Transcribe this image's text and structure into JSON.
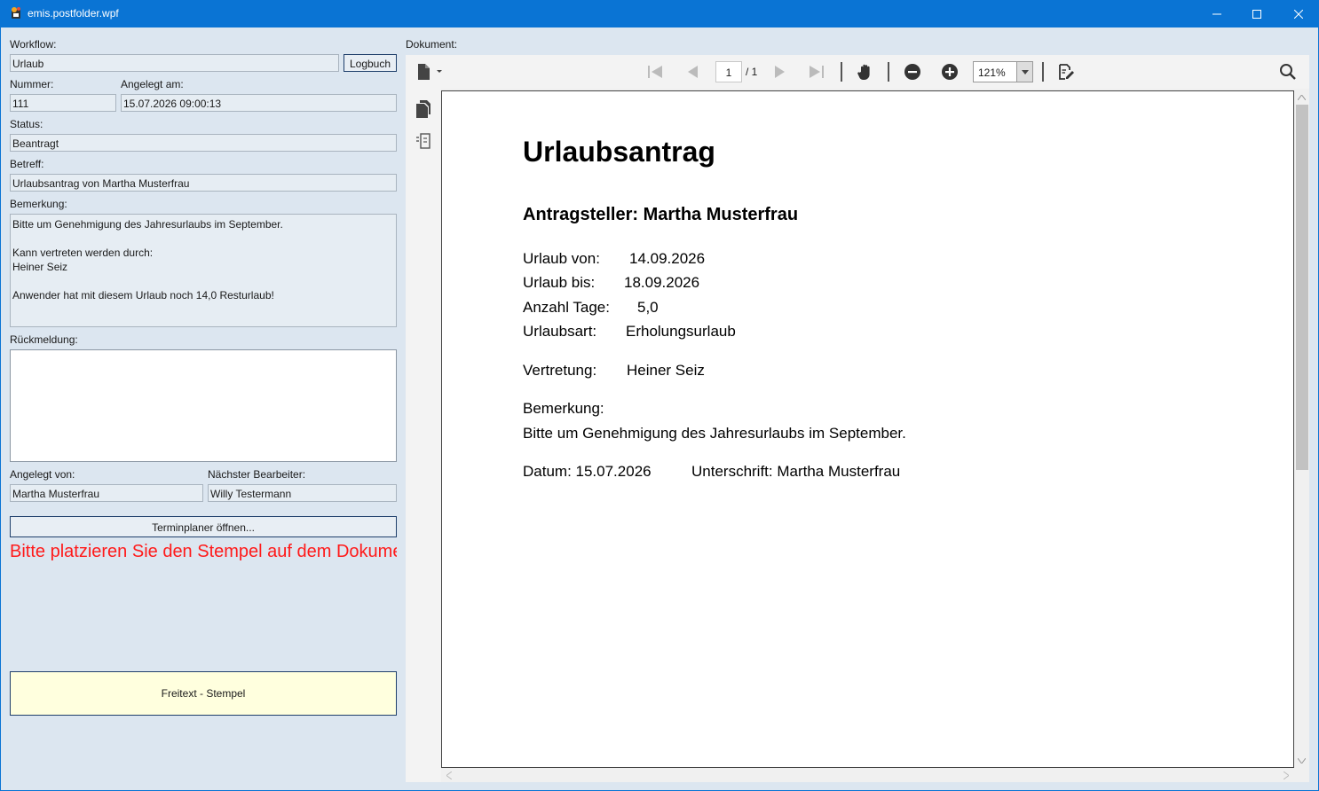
{
  "window": {
    "title": "emis.postfolder.wpf"
  },
  "form": {
    "workflow_label": "Workflow:",
    "workflow_value": "Urlaub",
    "logbuch_button": "Logbuch",
    "nummer_label": "Nummer:",
    "nummer_value": "111",
    "angelegt_am_label": "Angelegt am:",
    "angelegt_am_value": "15.07.2026 09:00:13",
    "status_label": "Status:",
    "status_value": "Beantragt",
    "betreff_label": "Betreff:",
    "betreff_value": "Urlaubsantrag von Martha Musterfrau",
    "bemerkung_label": "Bemerkung:",
    "bemerkung_value": "Bitte um Genehmigung des Jahresurlaubs im September.\n\nKann vertreten werden durch:\nHeiner Seiz\n\nAnwender hat mit diesem Urlaub noch 14,0 Resturlaub!",
    "rueckmeldung_label": "Rückmeldung:",
    "rueckmeldung_value": "",
    "angelegt_von_label": "Angelegt von:",
    "angelegt_von_value": "Martha Musterfrau",
    "naechster_bearbeiter_label": "Nächster Bearbeiter:",
    "naechster_bearbeiter_value": "Willy Testermann",
    "terminplaner_button": "Terminplaner öffnen...",
    "warning_text": "Bitte platzieren Sie den Stempel auf dem Dokument",
    "stamp_button": "Freitext - Stempel"
  },
  "viewer": {
    "label": "Dokument:",
    "page_current": "1",
    "page_total": "/ 1",
    "zoom": "121%"
  },
  "document": {
    "title": "Urlaubsantrag",
    "applicant": "Antragsteller: Martha Musterfrau",
    "urlaub_von_label": "Urlaub von:",
    "urlaub_von_value": "14.09.2026",
    "urlaub_bis_label": "Urlaub bis:",
    "urlaub_bis_value": "18.09.2026",
    "anzahl_tage_label": "Anzahl Tage:",
    "anzahl_tage_value": "5,0",
    "urlaubsart_label": "Urlaubsart:",
    "urlaubsart_value": "Erholungsurlaub",
    "vertretung_label": "Vertretung:",
    "vertretung_value": "Heiner Seiz",
    "bemerkung_label": "Bemerkung:",
    "bemerkung_value": "Bitte um Genehmigung des Jahresurlaubs im September.",
    "datum": "Datum: 15.07.2026",
    "unterschrift": "Unterschrift: Martha Musterfrau"
  },
  "colors": {
    "titlebar": "#0a74d4",
    "warning": "#ff1a1a",
    "stamp_bg": "#ffffde"
  }
}
